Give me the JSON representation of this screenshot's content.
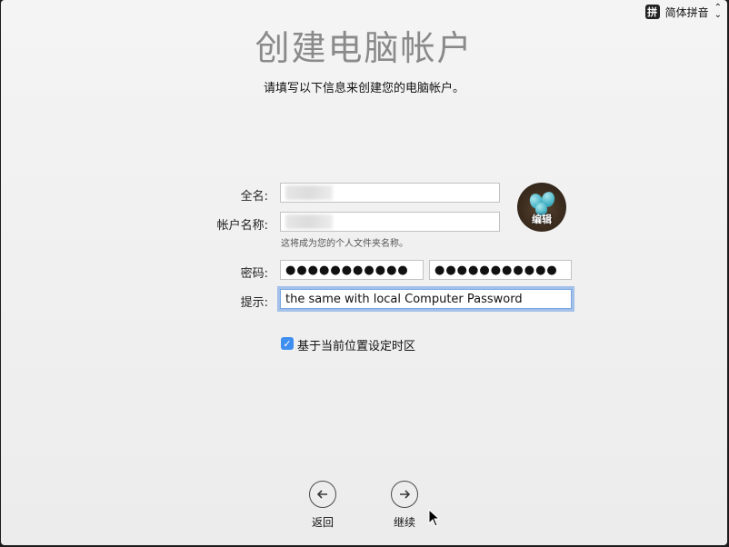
{
  "input_menu": {
    "badge": "拼",
    "label": "简体拼音"
  },
  "title": "创建电脑帐户",
  "subtitle": "请填写以下信息来创建您的电脑帐户。",
  "form": {
    "fullname_label": "全名:",
    "fullname_value": "",
    "account_label": "帐户名称:",
    "account_value": "",
    "account_hint": "这将成为您的个人文件夹名称。",
    "password_label": "密码:",
    "password_value": "●●●●●●●●●●●",
    "verify_value": "●●●●●●●●●●●",
    "hint_label": "提示:",
    "hint_value": "the same with local Computer Password"
  },
  "avatar": {
    "edit_label": "编辑"
  },
  "timezone": {
    "checked": true,
    "label": "基于当前位置设定时区"
  },
  "nav": {
    "back_label": "返回",
    "continue_label": "继续"
  }
}
